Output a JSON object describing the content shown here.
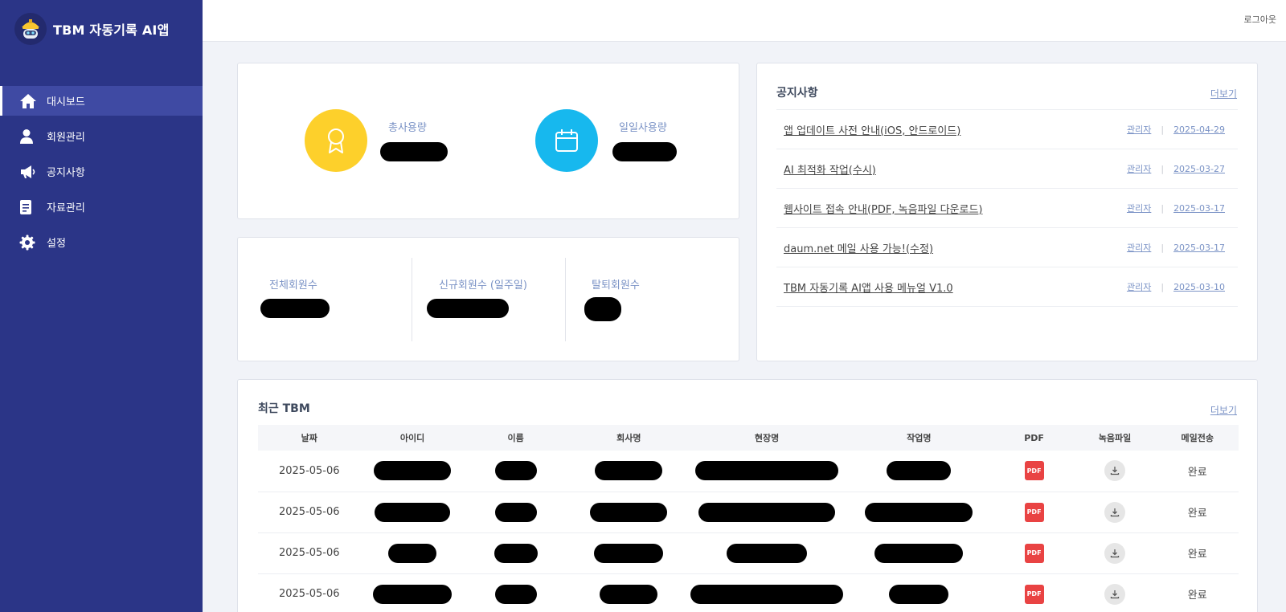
{
  "app": {
    "title": "TBM 자동기록 AI앱"
  },
  "header": {
    "logout_label": "로그아웃"
  },
  "sidebar": {
    "items": [
      {
        "label": "대시보드",
        "icon": "home-icon",
        "active": true
      },
      {
        "label": "회원관리",
        "icon": "user-icon",
        "active": false
      },
      {
        "label": "공지사항",
        "icon": "megaphone-icon",
        "active": false
      },
      {
        "label": "자료관리",
        "icon": "document-icon",
        "active": false
      },
      {
        "label": "설정",
        "icon": "gear-icon",
        "active": false
      }
    ]
  },
  "usage": {
    "total_label": "총사용량",
    "daily_label": "일일사용량",
    "total_color": "#fdd02b",
    "daily_color": "#17b8ee"
  },
  "members": {
    "total_label": "전체회원수",
    "new_label": "신규회원수 (일주일)",
    "withdrawn_label": "탈퇴회원수"
  },
  "notice": {
    "title": "공지사항",
    "more_label": "더보기",
    "items": [
      {
        "title": "앱 업데이트 사전 안내(iOS, 안드로이드)",
        "author": "관리자",
        "date": "2025-04-29"
      },
      {
        "title": "AI 최적화 작업(수시)",
        "author": "관리자",
        "date": "2025-03-27"
      },
      {
        "title": "웹사이트 접속 안내(PDF, 녹음파일 다운로드)",
        "author": "관리자",
        "date": "2025-03-17"
      },
      {
        "title": "daum.net 메일 사용 가능!(수정)",
        "author": "관리자",
        "date": "2025-03-17"
      },
      {
        "title": "TBM 자동기록 AI앱 사용 메뉴얼 V1.0",
        "author": "관리자",
        "date": "2025-03-10"
      }
    ]
  },
  "tbm": {
    "title": "최근 TBM",
    "more_label": "더보기",
    "columns": [
      "날짜",
      "아이디",
      "이름",
      "회사명",
      "현장명",
      "작업명",
      "PDF",
      "녹음파일",
      "메일전송"
    ],
    "pdf_badge": "PDF",
    "rows": [
      {
        "date": "2025-05-06",
        "mail_status": "완료"
      },
      {
        "date": "2025-05-06",
        "mail_status": "완료"
      },
      {
        "date": "2025-05-06",
        "mail_status": "완료"
      },
      {
        "date": "2025-05-06",
        "mail_status": "완료"
      }
    ]
  }
}
